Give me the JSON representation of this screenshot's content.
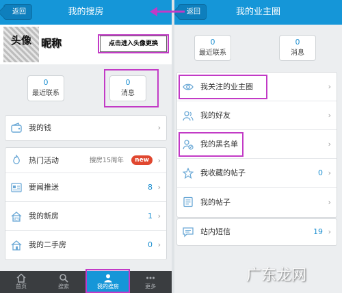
{
  "left": {
    "back_label": "返回",
    "title": "我的搜房",
    "avatar_text": "头像",
    "nickname": "昵称",
    "change_avatar_label": "点击进入头像更换",
    "stats": [
      {
        "value": "0",
        "label": "最近联系"
      },
      {
        "value": "0",
        "label": "消息"
      }
    ],
    "wallet": {
      "label": "我的钱",
      "icon": "wallet-icon"
    },
    "items": [
      {
        "label": "热门活动",
        "sub": "搜房15周年",
        "badge": "new",
        "icon": "fire-icon"
      },
      {
        "label": "要闻推送",
        "value": "8",
        "icon": "news-icon"
      },
      {
        "label": "我的新房",
        "value": "1",
        "icon": "new-house-icon"
      },
      {
        "label": "我的二手房",
        "value": "0",
        "icon": "house-icon"
      }
    ],
    "nav": [
      {
        "label": "首页",
        "icon": "home-icon"
      },
      {
        "label": "搜索",
        "icon": "search-icon"
      },
      {
        "label": "我的搜房",
        "icon": "user-icon",
        "active": true
      },
      {
        "label": "更多",
        "icon": "more-icon"
      }
    ]
  },
  "right": {
    "back_label": "返回",
    "title": "我的业主圈",
    "stats": [
      {
        "value": "0",
        "label": "最近联系"
      },
      {
        "value": "0",
        "label": "消息"
      }
    ],
    "items_group1": [
      {
        "label": "我关注的业主圈",
        "icon": "eye-icon"
      },
      {
        "label": "我的好友",
        "icon": "friends-icon"
      },
      {
        "label": "我的黑名单",
        "icon": "blacklist-icon"
      },
      {
        "label": "我收藏的帖子",
        "value": "0",
        "icon": "star-icon"
      },
      {
        "label": "我的帖子",
        "icon": "post-icon"
      }
    ],
    "items_group2": [
      {
        "label": "站内短信",
        "value": "19",
        "icon": "message-icon"
      }
    ]
  },
  "watermark": "广东龙网",
  "colors": {
    "header": "#1596d8",
    "accent": "#1d8fd1",
    "highlight": "#c23ac6",
    "badge": "#e0472f",
    "nav_bg": "#3a3d40"
  }
}
